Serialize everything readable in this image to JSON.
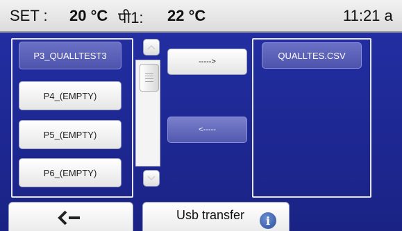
{
  "header": {
    "set_label": "SET :",
    "set_value": "20 °C",
    "probe_label": "पी1:",
    "probe_value": "22 °C",
    "time": "11:21 a"
  },
  "left_panel": {
    "items": [
      {
        "label": "P3_QUALLTEST3",
        "selected": true
      },
      {
        "label": "P4_(EMPTY)",
        "selected": false
      },
      {
        "label": "P5_(EMPTY)",
        "selected": false
      },
      {
        "label": "P6_(EMPTY)",
        "selected": false
      }
    ]
  },
  "right_panel": {
    "items": [
      {
        "label": "QUALLTES.CSV",
        "selected": true
      }
    ]
  },
  "transfer": {
    "to_right_label": "----->",
    "to_left_label": "<-----"
  },
  "bottom": {
    "usb_label": "Usb transfer",
    "info_icon": "i"
  },
  "icons": {
    "back": "arrow-left-icon",
    "info": "info-icon",
    "scroll_up": "chevron-up-icon",
    "scroll_down": "chevron-down-icon"
  },
  "colors": {
    "background": "#1e2894",
    "selected_item": "#5a60b8",
    "header": "#e8e8e8"
  }
}
